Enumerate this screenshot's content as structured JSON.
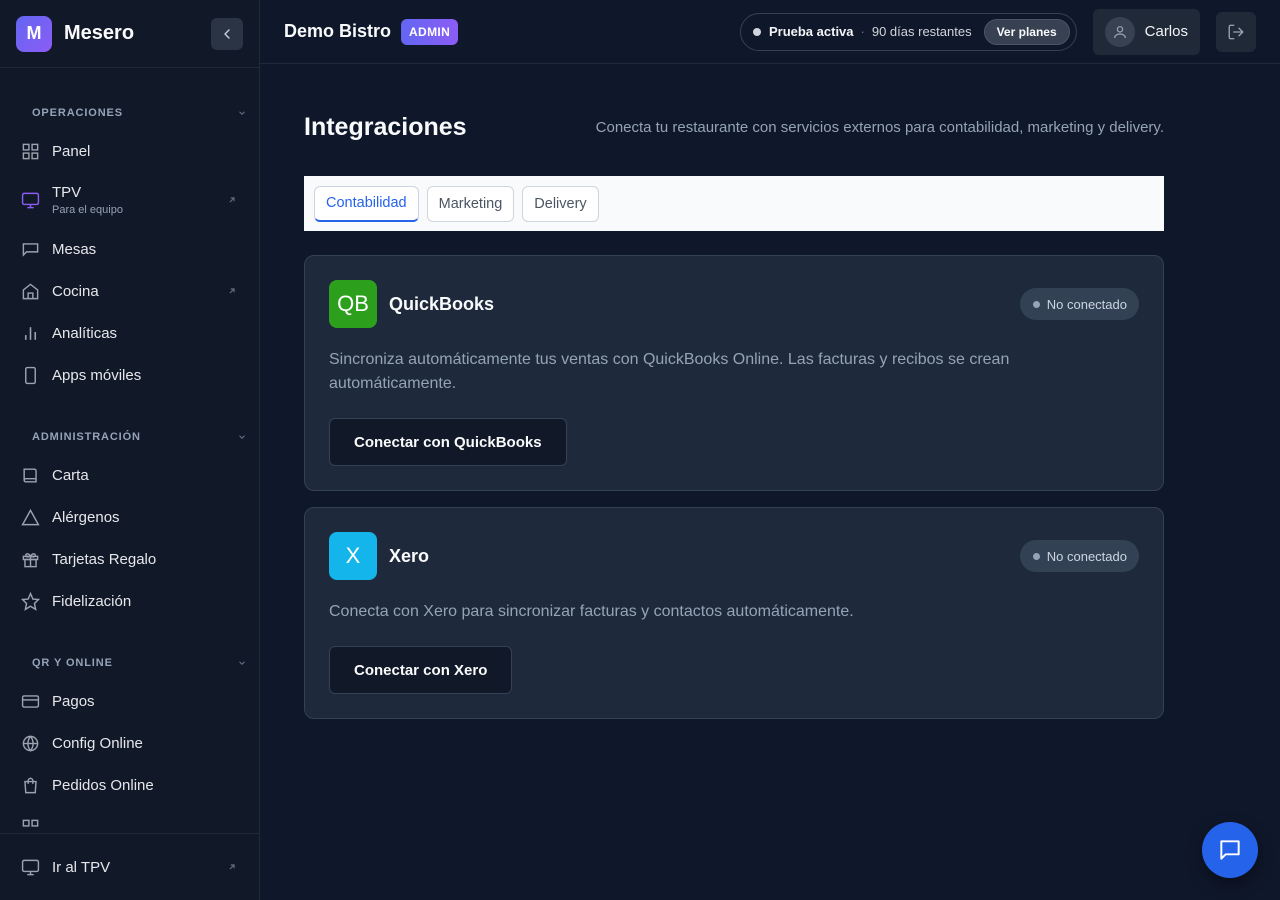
{
  "brand": {
    "logo_letter": "M",
    "name": "Mesero"
  },
  "sidebar": {
    "sections": [
      {
        "title": "OPERACIONES",
        "items": [
          {
            "label": "Panel",
            "icon": "grid-icon"
          },
          {
            "label": "TPV",
            "sublabel": "Para el equipo",
            "icon": "monitor-icon",
            "external": true
          },
          {
            "label": "Mesas",
            "icon": "table-icon"
          },
          {
            "label": "Cocina",
            "icon": "home-icon",
            "external": true
          },
          {
            "label": "Analíticas",
            "icon": "bar-chart-icon"
          },
          {
            "label": "Apps móviles",
            "icon": "smartphone-icon"
          }
        ]
      },
      {
        "title": "ADMINISTRACIÓN",
        "items": [
          {
            "label": "Carta",
            "icon": "book-icon"
          },
          {
            "label": "Alérgenos",
            "icon": "alert-triangle-icon"
          },
          {
            "label": "Tarjetas Regalo",
            "icon": "gift-icon"
          },
          {
            "label": "Fidelización",
            "icon": "star-icon"
          }
        ]
      },
      {
        "title": "QR Y ONLINE",
        "items": [
          {
            "label": "Pagos",
            "icon": "credit-card-icon"
          },
          {
            "label": "Config Online",
            "icon": "globe-icon"
          },
          {
            "label": "Pedidos Online",
            "icon": "shopping-bag-icon"
          }
        ]
      }
    ],
    "footer": {
      "label": "Ir al TPV",
      "icon": "monitor-icon"
    }
  },
  "header": {
    "business_name": "Demo Bistro",
    "role_badge": "ADMIN",
    "trial": {
      "status": "Prueba activa",
      "separator": "·",
      "remaining": "90 días restantes",
      "plans_button": "Ver planes"
    },
    "user_name": "Carlos"
  },
  "page": {
    "title": "Integraciones",
    "description": "Conecta tu restaurante con servicios externos para contabilidad, marketing y delivery.",
    "tabs": [
      {
        "label": "Contabilidad",
        "active": true
      },
      {
        "label": "Marketing",
        "active": false
      },
      {
        "label": "Delivery",
        "active": false
      }
    ],
    "integrations": [
      {
        "logo_text": "QB",
        "logo_color": "#2ca01c",
        "name": "QuickBooks",
        "status": "No conectado",
        "description": "Sincroniza automáticamente tus ventas con QuickBooks Online. Las facturas y recibos se crean automáticamente.",
        "button": "Conectar con QuickBooks"
      },
      {
        "logo_text": "X",
        "logo_color": "#13b5ea",
        "name": "Xero",
        "status": "No conectado",
        "description": "Conecta con Xero para sincronizar facturas y contactos automáticamente.",
        "button": "Conectar con Xero"
      }
    ]
  },
  "colors": {
    "accent": "#6366f1",
    "primary_blue": "#2563eb",
    "background": "#0f172a",
    "sidebar": "#111827",
    "card": "#1e293b"
  }
}
